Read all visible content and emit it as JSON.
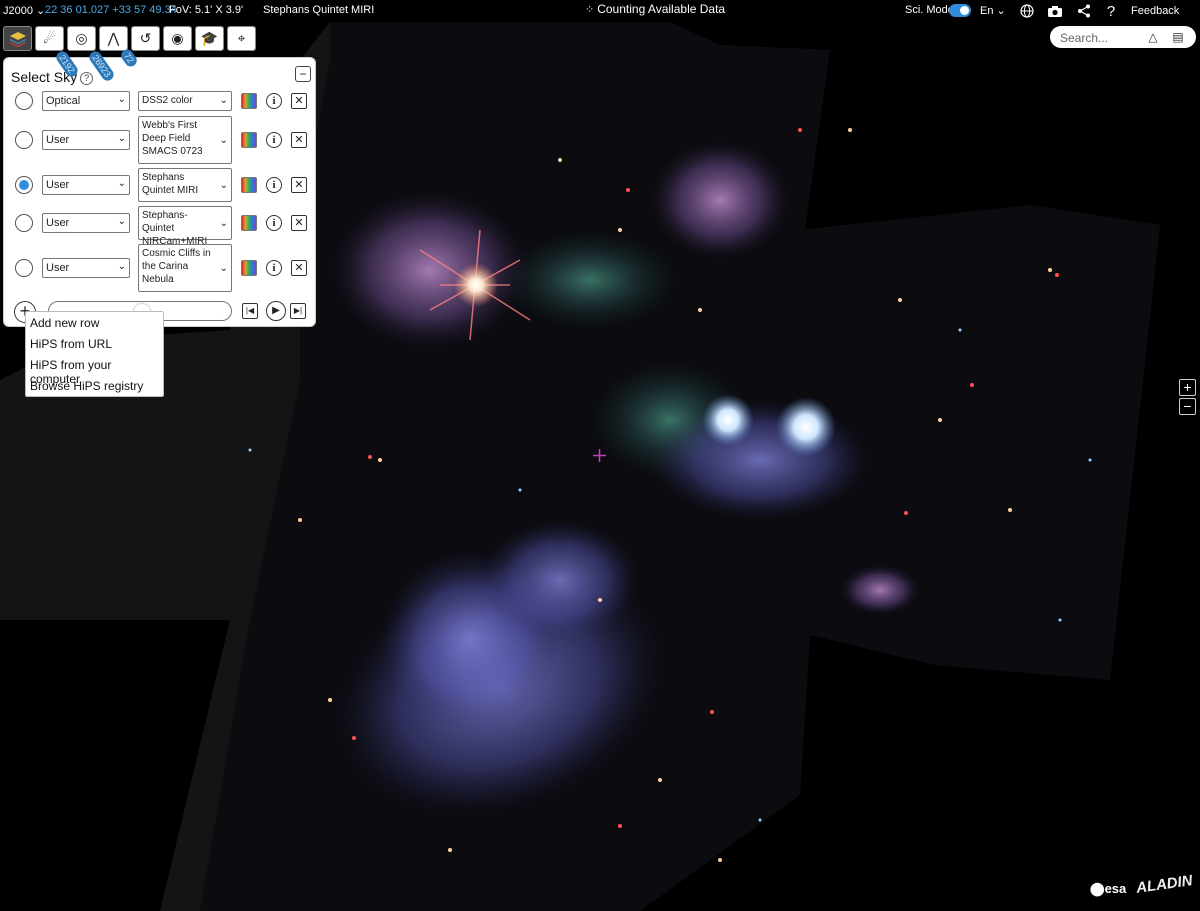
{
  "topbar": {
    "frame": "J2000",
    "coords": "22 36 01.027 +33 57 49.34",
    "fov": "FoV: 5.1' X 3.9'",
    "target": "Stephans Quintet MIRI",
    "status": "Counting Available Data",
    "sci_mode": "Sci. Mode",
    "lang": "En",
    "feedback": "Feedback"
  },
  "search": {
    "placeholder": "Search..."
  },
  "badges": [
    "2192",
    "26923",
    "72"
  ],
  "panel": {
    "title": "Select Sky",
    "rows": [
      {
        "category": "Optical",
        "survey": "DSS2 color",
        "selected": false
      },
      {
        "category": "User",
        "survey": "Webb's First Deep Field SMACS 0723",
        "selected": false
      },
      {
        "category": "User",
        "survey": "Stephans Quintet MIRI",
        "selected": true
      },
      {
        "category": "User",
        "survey": "Stephans-Quintet NIRCam+MIRI",
        "selected": false
      },
      {
        "category": "User",
        "survey": "Cosmic Cliffs in the Carina Nebula",
        "selected": false
      }
    ]
  },
  "menu": {
    "items": [
      "Add new row",
      "HiPS from URL",
      "HiPS from your computer",
      "Browse HiPS registry"
    ]
  },
  "footer": {
    "esa": "esa",
    "aladin": "ALADIN"
  },
  "colors": {
    "accent": "#2f8ddb",
    "coords": "#4aa8e8",
    "reticle": "#c040c0"
  }
}
